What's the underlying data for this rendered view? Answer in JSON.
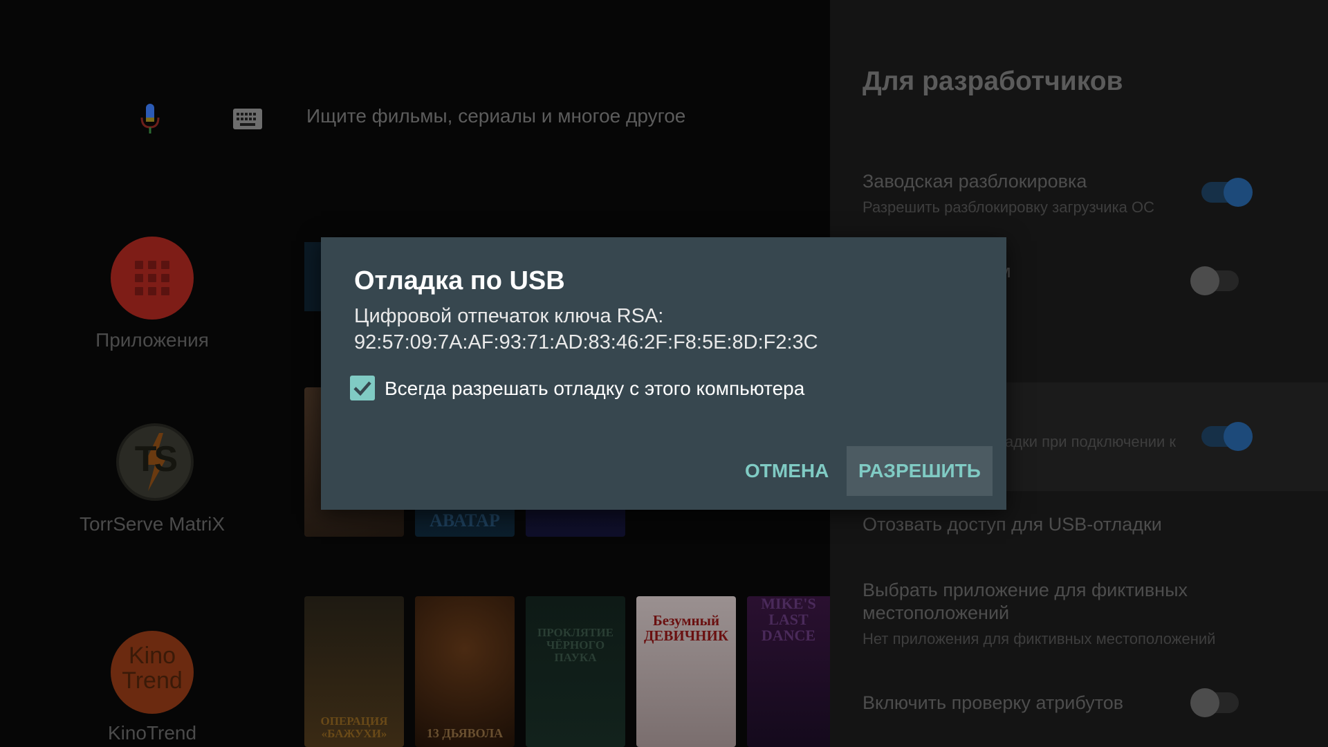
{
  "search": {
    "mic_icon": "microphone-icon",
    "keyboard_icon": "keyboard-icon",
    "placeholder": "Ищите фильмы, сериалы и многое другое"
  },
  "apps": [
    {
      "label": "Приложения",
      "icon": "apps-grid-icon"
    },
    {
      "label": "TorrServe MatriX",
      "icon": "torrserve-logo",
      "logo_text": "TS"
    },
    {
      "label": "KinoTrend",
      "icon": "kinotrend-logo",
      "logo_text": "Kino Trend"
    }
  ],
  "posters": {
    "row2": [
      {
        "title": ""
      },
      {
        "title": "АВАТАР"
      },
      {
        "title": ""
      }
    ],
    "row3": [
      {
        "title": "ОПЕРАЦИЯ «БАЖУХИ»"
      },
      {
        "title": "13 ДЬЯВОЛА"
      },
      {
        "title": "ПРОКЛЯТИЕ ЧЁРНОГО ПАУКА"
      },
      {
        "title": "Безумный ДЕВИЧНИК"
      },
      {
        "title": "MAGIC MIKE'S LAST DANCE"
      }
    ]
  },
  "developer": {
    "title": "Для разработчиков",
    "settings": [
      {
        "title": "Заводская разблокировка",
        "subtitle": "Разрешить разблокировку загрузчика ОС",
        "toggle": "on"
      },
      {
        "title": "м",
        "toggle": "off"
      },
      {
        "title": "",
        "subtitle": "адки при подключении к",
        "toggle": "on"
      },
      {
        "title": "Отозвать доступ для USB-отладки"
      },
      {
        "title": "Выбрать приложение для фиктивных местоположений",
        "subtitle": "Нет приложения для фиктивных местоположений"
      },
      {
        "title": "Включить проверку атрибутов",
        "toggle": "off"
      }
    ]
  },
  "dialog": {
    "title": "Отладка по USB",
    "fingerprint_label": "Цифровой отпечаток ключа RSA:",
    "fingerprint_value": "92:57:09:7A:AF:93:71:AD:83:46:2F:F8:5E:8D:F2:3C",
    "checkbox_label": "Всегда разрешать отладку с этого компьютера",
    "checkbox_checked": true,
    "cancel_label": "ОТМЕНА",
    "allow_label": "РАЗРЕШИТЬ",
    "accent": "#80cbc4",
    "background": "#37474f"
  }
}
